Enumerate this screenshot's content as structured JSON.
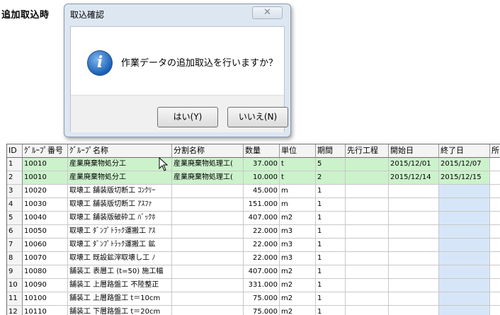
{
  "page_label": "追加取込時",
  "dialog": {
    "title": "取込確認",
    "close_label": "✕",
    "message": "作業データの追加取込を行いますか？",
    "yes_label": "はい(Y)",
    "no_label": "いいえ(N)"
  },
  "grid": {
    "columns": [
      "ID",
      "ｸﾞﾙｰﾌﾟ番号",
      "ｸﾞﾙｰﾌﾟ名称",
      "分割名称",
      "数量",
      "単位",
      "期間",
      "先行工程",
      "開始日",
      "終了日",
      "所"
    ],
    "rows": [
      {
        "id": "1",
        "group_no": "10010",
        "group_name": "産業廃棄物処分工",
        "split_name": "産業廃棄物処理工(",
        "qty": "37.000",
        "unit": "t",
        "period": "5",
        "prev": "",
        "start": "2015/12/01",
        "end": "2015/12/07",
        "highlight": true
      },
      {
        "id": "2",
        "group_no": "10010",
        "group_name": "産業廃棄物処分工",
        "split_name": "産業廃棄物処理工(",
        "qty": "10.000",
        "unit": "t",
        "period": "2",
        "prev": "",
        "start": "2015/12/14",
        "end": "2015/12/15",
        "highlight": true
      },
      {
        "id": "3",
        "group_no": "10020",
        "group_name": "取壊工 舗装版切断工 ｺﾝｸﾘｰ",
        "split_name": "",
        "qty": "45.000",
        "unit": "m",
        "period": "1",
        "prev": "",
        "start": "",
        "end": "",
        "highlight": false
      },
      {
        "id": "4",
        "group_no": "10030",
        "group_name": "取壊工 舗装版切断工 ｱｽﾌｧ",
        "split_name": "",
        "qty": "151.000",
        "unit": "m",
        "period": "1",
        "prev": "",
        "start": "",
        "end": "",
        "highlight": false
      },
      {
        "id": "5",
        "group_no": "10040",
        "group_name": "取壊工 舗装版破砕工 ﾊﾞｯｸﾎ",
        "split_name": "",
        "qty": "407.000",
        "unit": "m2",
        "period": "1",
        "prev": "",
        "start": "",
        "end": "",
        "highlight": false
      },
      {
        "id": "6",
        "group_no": "10050",
        "group_name": "取壊工 ﾀﾞﾝﾌﾟﾄﾗｯｸ運搬工 ｱｽ",
        "split_name": "",
        "qty": "22.000",
        "unit": "m3",
        "period": "1",
        "prev": "",
        "start": "",
        "end": "",
        "highlight": false
      },
      {
        "id": "7",
        "group_no": "10060",
        "group_name": "取壊工 ﾀﾞﾝﾌﾟﾄﾗｯｸ運搬工 鉱",
        "split_name": "",
        "qty": "22.000",
        "unit": "m3",
        "period": "1",
        "prev": "",
        "start": "",
        "end": "",
        "highlight": false
      },
      {
        "id": "8",
        "group_no": "10070",
        "group_name": "取壊工 既設鉱滓取壊し工 ﾉ",
        "split_name": "",
        "qty": "22.000",
        "unit": "m3",
        "period": "1",
        "prev": "",
        "start": "",
        "end": "",
        "highlight": false
      },
      {
        "id": "9",
        "group_no": "10080",
        "group_name": "舗装工 表層工 (t=50) 施工幅",
        "split_name": "",
        "qty": "407.000",
        "unit": "m2",
        "period": "1",
        "prev": "",
        "start": "",
        "end": "",
        "highlight": false
      },
      {
        "id": "10",
        "group_no": "10090",
        "group_name": "舗装工 上層路盤工 不陸整正",
        "split_name": "",
        "qty": "331.000",
        "unit": "m2",
        "period": "1",
        "prev": "",
        "start": "",
        "end": "",
        "highlight": false
      },
      {
        "id": "11",
        "group_no": "10100",
        "group_name": "舗装工 上層路盤工 t＝10cm",
        "split_name": "",
        "qty": "75.000",
        "unit": "m2",
        "period": "1",
        "prev": "",
        "start": "",
        "end": "",
        "highlight": false
      },
      {
        "id": "12",
        "group_no": "10110",
        "group_name": "舗装工 下層路盤工 t＝20cm",
        "split_name": "",
        "qty": "75.000",
        "unit": "m2",
        "period": "1",
        "prev": "",
        "start": "",
        "end": "",
        "highlight": false
      }
    ]
  },
  "colors": {
    "highlight_row": "#ccf2cc",
    "end_date_column": "#d6e6f8",
    "dialog_frame": "#dde7f2"
  }
}
